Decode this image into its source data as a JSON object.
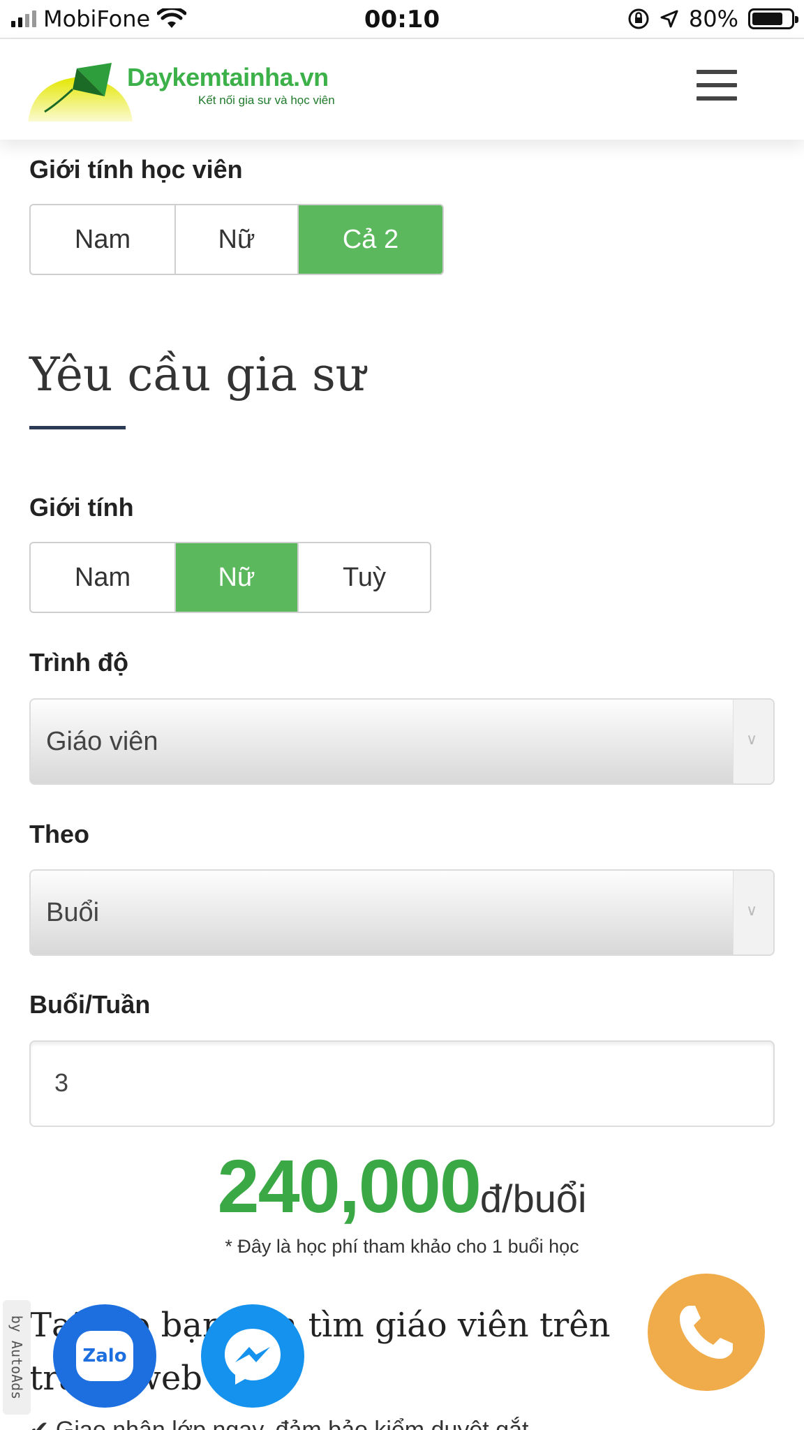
{
  "status_bar": {
    "carrier": "MobiFone",
    "time": "00:10",
    "battery_percent": "80%",
    "battery_level": 0.8
  },
  "header": {
    "brand_name": "Daykemtainha.vn",
    "brand_tagline": "Kết nối gia sư và học viên"
  },
  "student_gender": {
    "label": "Giới tính học viên",
    "options": [
      "Nam",
      "Nữ",
      "Cả 2"
    ],
    "selected": "Cả 2"
  },
  "tutor_requirements": {
    "title": "Yêu cầu gia sư",
    "gender": {
      "label": "Giới tính",
      "options": [
        "Nam",
        "Nữ",
        "Tuỳ"
      ],
      "selected": "Nữ"
    },
    "level": {
      "label": "Trình độ",
      "value": "Giáo viên"
    },
    "by": {
      "label": "Theo",
      "value": "Buổi"
    },
    "sessions_per_week": {
      "label": "Buổi/Tuần",
      "value": "3"
    }
  },
  "price": {
    "amount": "240,000",
    "unit": "đ/buổi",
    "note": "* Đây là học phí tham khảo cho 1 buổi học"
  },
  "bottom": {
    "heading": "Tại sao bạn nên tìm giáo viên trên trang web trên",
    "bullet": "✔ Giao nhận lớp ngay, đảm bảo kiểm duyệt gắt"
  },
  "floating": {
    "autoads_label": "by AutoAds",
    "zalo_label": "Zalo"
  },
  "colors": {
    "brand_green": "#3db149",
    "active_option": "#5cb85c",
    "price_green": "#3aa845",
    "zalo_blue": "#1d6fe0",
    "messenger_blue": "#1592ee",
    "call_orange": "#f0ab4b"
  },
  "icons": {
    "menu": "hamburger-icon",
    "call": "phone-icon",
    "messenger": "messenger-icon",
    "zalo": "zalo-icon",
    "select_arrow": "chevron-down-icon"
  }
}
